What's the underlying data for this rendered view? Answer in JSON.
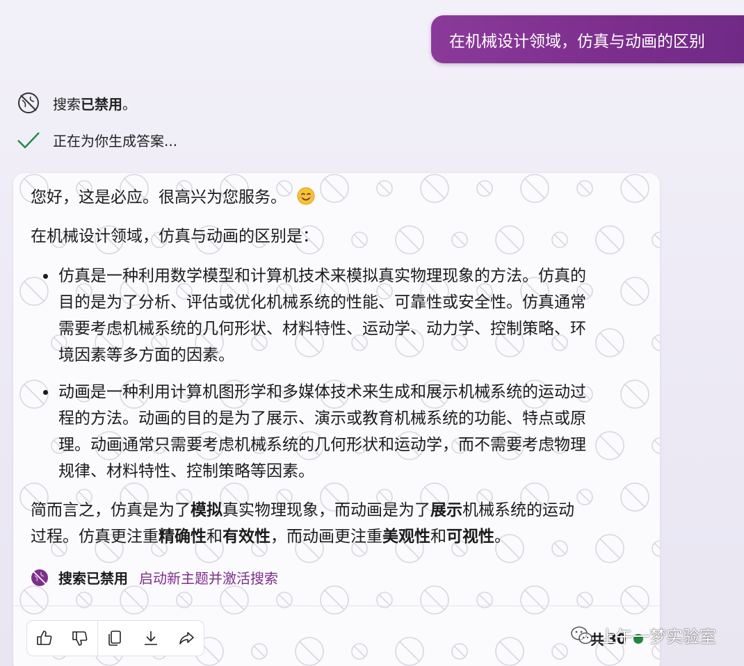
{
  "user_message": "在机械设计领域，仿真与动画的区别",
  "status": {
    "search_prefix": "搜索",
    "search_bold": "已禁用",
    "search_suffix": "。",
    "generating": "正在为你生成答案..."
  },
  "answer": {
    "greeting": "您好，这是必应。很高兴为您服务。",
    "intro": "在机械设计领域，仿真与动画的区别是：",
    "bullets": [
      {
        "lines": [
          "仿真是一种利用数学模型和计算机技术来模拟真实物理现象的方法。仿真的",
          "目的是为了分析、评估或优化机械系统的性能、可靠性或安全性。仿真通常",
          "需要考虑机械系统的几何形状、材料特性、运动学、动力学、控制策略、环",
          "境因素等多方面的因素。"
        ]
      },
      {
        "lines": [
          "动画是一种利用计算机图形学和多媒体技术来生成和展示机械系统的运动过",
          "程的方法。动画的目的是为了展示、演示或教育机械系统的功能、特点或原",
          "理。动画通常只需要考虑机械系统的几何形状和运动学，而不需要考虑物理",
          "规律、材料特性、控制策略等因素。"
        ]
      }
    ],
    "summary_line1": [
      {
        "t": "简而言之，仿真是为了",
        "b": false
      },
      {
        "t": "模拟",
        "b": true
      },
      {
        "t": "真实物理现象，而动画是为了",
        "b": false
      },
      {
        "t": "展示",
        "b": true
      },
      {
        "t": "机械系统的运动",
        "b": false
      }
    ],
    "summary_line2": [
      {
        "t": "过程。仿真更注重",
        "b": false
      },
      {
        "t": "精确性",
        "b": true
      },
      {
        "t": "和",
        "b": false
      },
      {
        "t": "有效性",
        "b": true
      },
      {
        "t": "，而动画更注重",
        "b": false
      },
      {
        "t": "美观性",
        "b": true
      },
      {
        "t": "和",
        "b": false
      },
      {
        "t": "可视性",
        "b": true
      },
      {
        "t": "。",
        "b": false
      }
    ]
  },
  "search_disabled": {
    "label": "搜索已禁用",
    "link": "启动新主题并激活搜索"
  },
  "footer": {
    "count_prefix": "共",
    "count_value": "30",
    "watermark": "上午一梦实验室"
  },
  "colors": {
    "accent": "#7d2f8a",
    "check": "#1e8a3d"
  }
}
